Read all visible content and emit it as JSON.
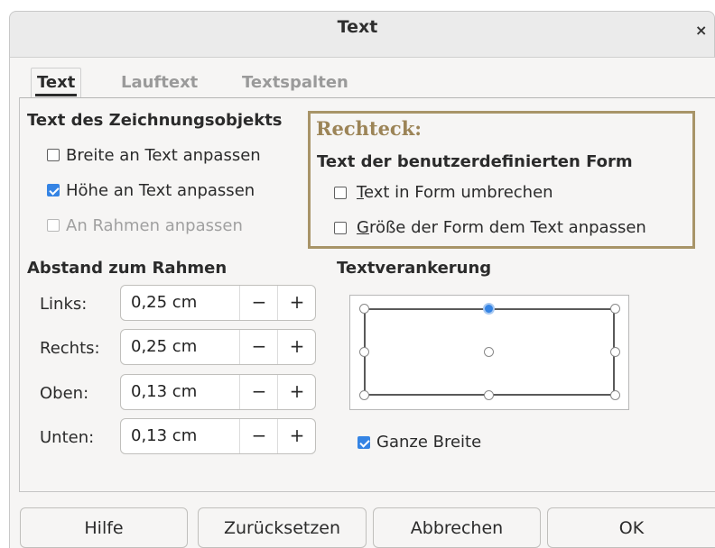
{
  "window": {
    "title": "Text",
    "close": "×"
  },
  "tabs": [
    {
      "label": "Text"
    },
    {
      "label": "Lauftext"
    },
    {
      "label": "Textspalten"
    }
  ],
  "drawing_object": {
    "heading": "Text des Zeichnungsobjekts",
    "options": [
      {
        "label": "Breite an Text anpassen",
        "checked": false
      },
      {
        "label": "Höhe an Text anpassen",
        "checked": true
      },
      {
        "label": "An Rahmen anpassen",
        "checked": false,
        "disabled": true
      }
    ]
  },
  "custom_shape": {
    "callout": "Rechteck:",
    "heading": "Text der benutzerdefinierten Form",
    "wrap": {
      "mnemonic": "T",
      "rest": "ext in Form umbrechen",
      "checked": false
    },
    "resize": {
      "mnemonic": "G",
      "rest": "röße der Form dem Text anpassen",
      "checked": false
    }
  },
  "spacing": {
    "heading": "Abstand zum Rahmen",
    "rows": [
      {
        "label": "Links:",
        "value": "0,25 cm"
      },
      {
        "label": "Rechts:",
        "value": "0,25 cm"
      },
      {
        "label": "Oben:",
        "value": "0,13 cm"
      },
      {
        "label": "Unten:",
        "value": "0,13 cm"
      }
    ],
    "minus": "−",
    "plus": "+"
  },
  "anchor": {
    "heading": "Textverankerung",
    "selected": "top-center",
    "full_width": {
      "label": "Ganze Breite",
      "checked": true
    }
  },
  "buttons": {
    "help": "Hilfe",
    "reset": "Zurücksetzen",
    "cancel": "Abbrechen",
    "ok": "OK"
  },
  "colors": {
    "accent": "#3584e4",
    "callout_border": "#a89468"
  }
}
